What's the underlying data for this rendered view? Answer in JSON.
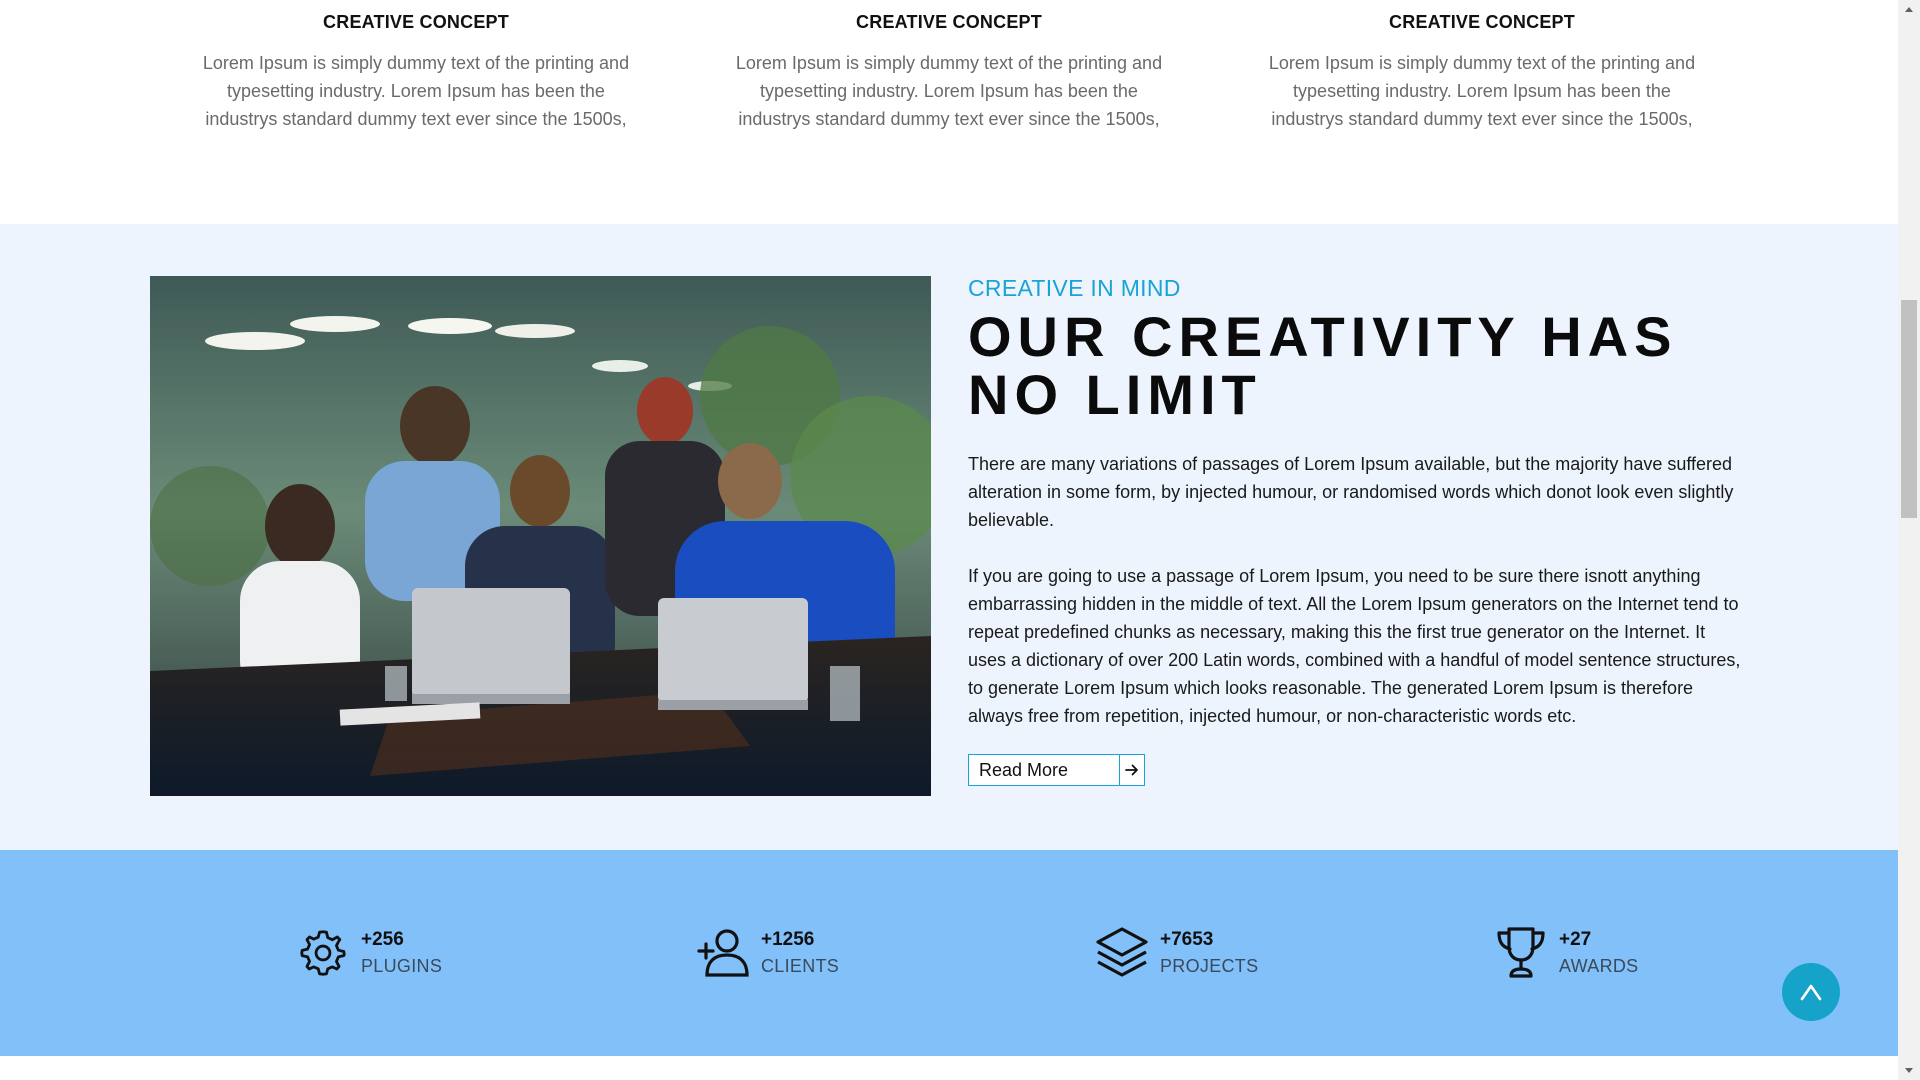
{
  "features": [
    {
      "title": "CREATIVE CONCEPT",
      "text": "Lorem Ipsum is simply dummy text of the printing and typesetting industry. Lorem Ipsum has been the industrys standard dummy text ever since the 1500s,"
    },
    {
      "title": "CREATIVE CONCEPT",
      "text": "Lorem Ipsum is simply dummy text of the printing and typesetting industry. Lorem Ipsum has been the industrys standard dummy text ever since the 1500s,"
    },
    {
      "title": "CREATIVE CONCEPT",
      "text": "Lorem Ipsum is simply dummy text of the printing and typesetting industry. Lorem Ipsum has been the industrys standard dummy text ever since the 1500s,"
    }
  ],
  "creative": {
    "kicker": "CREATIVE IN MIND",
    "headline_line1": "OUR CREATIVITY HAS",
    "headline_line2": "NO LIMIT",
    "para1": "There are many variations of passages of Lorem Ipsum available, but the majority have suffered alteration in some form, by injected humour, or randomised words which donot look even slightly believable.",
    "para2": "If you are going to use a passage of Lorem Ipsum, you need to be sure there isnott anything embarrassing hidden in the middle of text. All the Lorem Ipsum generators on the Internet tend to repeat predefined chunks as necessary, making this the first true generator on the Internet. It uses a dictionary of over 200 Latin words, combined with a handful of model sentence structures, to generate Lorem Ipsum which looks reasonable. The generated Lorem Ipsum is therefore always free from repetition, injected humour, or non-characteristic words etc.",
    "read_more_label": "Read More",
    "read_more_icon": "arrow-right-icon",
    "photo_icon": "team-meeting-photo"
  },
  "stats": [
    {
      "icon": "gear-icon",
      "value": "+256",
      "label": "PLUGINS"
    },
    {
      "icon": "add-user-icon",
      "value": "+1256",
      "label": "CLIENTS"
    },
    {
      "icon": "layers-icon",
      "value": "+7653",
      "label": "PROJECTS"
    },
    {
      "icon": "trophy-icon",
      "value": "+27",
      "label": "AWARDS"
    }
  ],
  "back_to_top": {
    "label": "^",
    "icon": "chevron-up-icon"
  },
  "colors": {
    "accent": "#1aa3d6",
    "section_bg": "#edf4fd",
    "stats_bg": "#82c0fa",
    "to_top_bg": "#16a3c9"
  }
}
